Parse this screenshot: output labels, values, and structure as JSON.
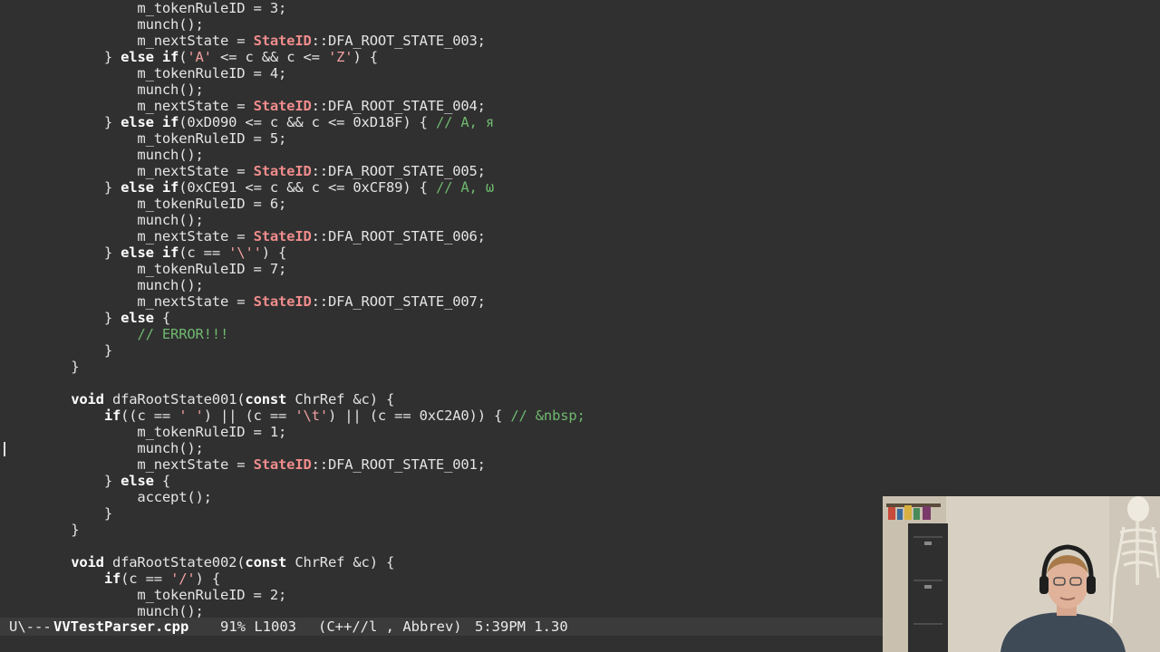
{
  "editor": {
    "lines": [
      [
        {
          "t": "                m_tokenRuleID = 3;"
        }
      ],
      [
        {
          "t": "                munch();"
        }
      ],
      [
        {
          "t": "                m_nextState = "
        },
        {
          "t": "StateID",
          "c": "type"
        },
        {
          "t": "::DFA_ROOT_STATE_003;"
        }
      ],
      [
        {
          "t": "            } "
        },
        {
          "t": "else if",
          "c": "kw"
        },
        {
          "t": "("
        },
        {
          "t": "'A'",
          "c": "str"
        },
        {
          "t": " <= c && c <= "
        },
        {
          "t": "'Z'",
          "c": "str"
        },
        {
          "t": ") {"
        }
      ],
      [
        {
          "t": "                m_tokenRuleID = 4;"
        }
      ],
      [
        {
          "t": "                munch();"
        }
      ],
      [
        {
          "t": "                m_nextState = "
        },
        {
          "t": "StateID",
          "c": "type"
        },
        {
          "t": "::DFA_ROOT_STATE_004;"
        }
      ],
      [
        {
          "t": "            } "
        },
        {
          "t": "else if",
          "c": "kw"
        },
        {
          "t": "(0xD090 <= c && c <= 0xD18F) { "
        },
        {
          "t": "// А, я",
          "c": "cmt"
        }
      ],
      [
        {
          "t": "                m_tokenRuleID = 5;"
        }
      ],
      [
        {
          "t": "                munch();"
        }
      ],
      [
        {
          "t": "                m_nextState = "
        },
        {
          "t": "StateID",
          "c": "type"
        },
        {
          "t": "::DFA_ROOT_STATE_005;"
        }
      ],
      [
        {
          "t": "            } "
        },
        {
          "t": "else if",
          "c": "kw"
        },
        {
          "t": "(0xCE91 <= c && c <= 0xCF89) { "
        },
        {
          "t": "// Α, ω",
          "c": "cmt"
        }
      ],
      [
        {
          "t": "                m_tokenRuleID = 6;"
        }
      ],
      [
        {
          "t": "                munch();"
        }
      ],
      [
        {
          "t": "                m_nextState = "
        },
        {
          "t": "StateID",
          "c": "type"
        },
        {
          "t": "::DFA_ROOT_STATE_006;"
        }
      ],
      [
        {
          "t": "            } "
        },
        {
          "t": "else if",
          "c": "kw"
        },
        {
          "t": "(c == "
        },
        {
          "t": "'\\''",
          "c": "str"
        },
        {
          "t": ") {"
        }
      ],
      [
        {
          "t": "                m_tokenRuleID = 7;"
        }
      ],
      [
        {
          "t": "                munch();"
        }
      ],
      [
        {
          "t": "                m_nextState = "
        },
        {
          "t": "StateID",
          "c": "type"
        },
        {
          "t": "::DFA_ROOT_STATE_007;"
        }
      ],
      [
        {
          "t": "            } "
        },
        {
          "t": "else",
          "c": "kw"
        },
        {
          "t": " {"
        }
      ],
      [
        {
          "t": "                "
        },
        {
          "t": "// ERROR!!!",
          "c": "cmt"
        }
      ],
      [
        {
          "t": "            }"
        }
      ],
      [
        {
          "t": "        }"
        }
      ],
      [
        {
          "t": ""
        }
      ],
      [
        {
          "t": "        "
        },
        {
          "t": "void",
          "c": "kw"
        },
        {
          "t": " dfaRootState001("
        },
        {
          "t": "const",
          "c": "kw"
        },
        {
          "t": " ChrRef &c) {"
        }
      ],
      [
        {
          "t": "            "
        },
        {
          "t": "if",
          "c": "kw"
        },
        {
          "t": "((c == "
        },
        {
          "t": "' '",
          "c": "str"
        },
        {
          "t": ") || (c == "
        },
        {
          "t": "'\\t'",
          "c": "str"
        },
        {
          "t": ") || (c == 0xC2A0)) { "
        },
        {
          "t": "// &nbsp;",
          "c": "cmt"
        }
      ],
      [
        {
          "t": "                m_tokenRuleID = 1;"
        }
      ],
      [
        {
          "t": "                munch();"
        }
      ],
      [
        {
          "t": "                m_nextState = "
        },
        {
          "t": "StateID",
          "c": "type"
        },
        {
          "t": "::DFA_ROOT_STATE_001;"
        }
      ],
      [
        {
          "t": "            } "
        },
        {
          "t": "else",
          "c": "kw"
        },
        {
          "t": " {"
        }
      ],
      [
        {
          "t": "                accept();"
        }
      ],
      [
        {
          "t": "            }"
        }
      ],
      [
        {
          "t": "        }"
        }
      ],
      [
        {
          "t": ""
        }
      ],
      [
        {
          "t": "        "
        },
        {
          "t": "void",
          "c": "kw"
        },
        {
          "t": " dfaRootState002("
        },
        {
          "t": "const",
          "c": "kw"
        },
        {
          "t": " ChrRef &c) {"
        }
      ],
      [
        {
          "t": "            "
        },
        {
          "t": "if",
          "c": "kw"
        },
        {
          "t": "(c == "
        },
        {
          "t": "'/'",
          "c": "str"
        },
        {
          "t": ") {"
        }
      ],
      [
        {
          "t": "                m_tokenRuleID = 2;"
        }
      ],
      [
        {
          "t": "                munch();"
        }
      ]
    ]
  },
  "mode_line": {
    "status": "U\\---",
    "buffer_name": "VVTestParser.cpp",
    "position": "91% L1003",
    "modes": "(C++//l , Abbrev)",
    "time_load": "5:39PM 1.30"
  },
  "colors": {
    "background": "#303030",
    "foreground": "#e4e4e4",
    "keyword": "#ffffff",
    "type": "#f08c8c",
    "string": "#f2a0a0",
    "comment": "#6fb86f",
    "mode_line_bg": "#3b3b3b"
  }
}
